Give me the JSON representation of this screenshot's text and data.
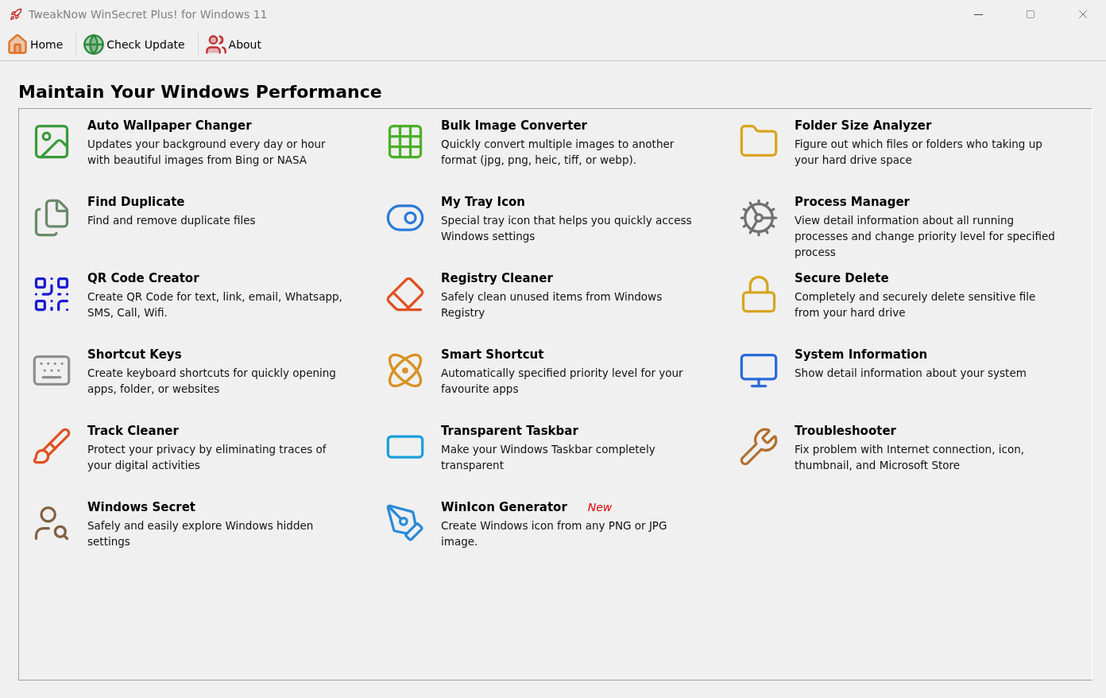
{
  "window": {
    "title": "TweakNow WinSecret Plus! for Windows 11"
  },
  "toolbar": [
    {
      "label": "Home"
    },
    {
      "label": "Check Update"
    },
    {
      "label": "About"
    }
  ],
  "heading": "Maintain Your Windows Performance",
  "tools": [
    {
      "name": "Auto Wallpaper Changer",
      "description": "Updates your background every day or hour with beautiful images from Bing or NASA"
    },
    {
      "name": "Bulk Image Converter",
      "description": "Quickly convert multiple images to another format (jpg, png, heic, tiff, or webp)."
    },
    {
      "name": "Folder Size Analyzer",
      "description": "Figure out which files or folders who taking up your hard drive space"
    },
    {
      "name": "Find Duplicate",
      "description": "Find and remove duplicate files"
    },
    {
      "name": "My Tray Icon",
      "description": "Special tray icon that helps you quickly access Windows settings"
    },
    {
      "name": "Process Manager",
      "description": "View detail information about all running processes and change priority level for specified process"
    },
    {
      "name": "QR Code Creator",
      "description": "Create QR Code for text, link, email, Whatsapp, SMS, Call, Wifi."
    },
    {
      "name": "Registry Cleaner",
      "description": "Safely clean unused items from Windows Registry"
    },
    {
      "name": "Secure Delete",
      "description": "Completely and securely delete sensitive file from your hard drive"
    },
    {
      "name": "Shortcut Keys",
      "description": "Create keyboard shortcuts for quickly opening apps, folder, or websites"
    },
    {
      "name": "Smart Shortcut",
      "description": "Automatically specified priority level for your favourite apps"
    },
    {
      "name": "System Information",
      "description": "Show detail information about your system"
    },
    {
      "name": "Track Cleaner",
      "description": "Protect your privacy by eliminating traces of your digital activities"
    },
    {
      "name": "Transparent Taskbar",
      "description": "Make your Windows Taskbar completely transparent"
    },
    {
      "name": "Troubleshooter",
      "description": "Fix problem with Internet connection, icon, thumbnail, and Microsoft Store"
    },
    {
      "name": "Windows Secret",
      "description": "Safely and easily explore Windows hidden settings"
    },
    {
      "name": "WinIcon Generator",
      "description": "Create Windows icon from any PNG or JPG image.",
      "badge": "New"
    }
  ]
}
